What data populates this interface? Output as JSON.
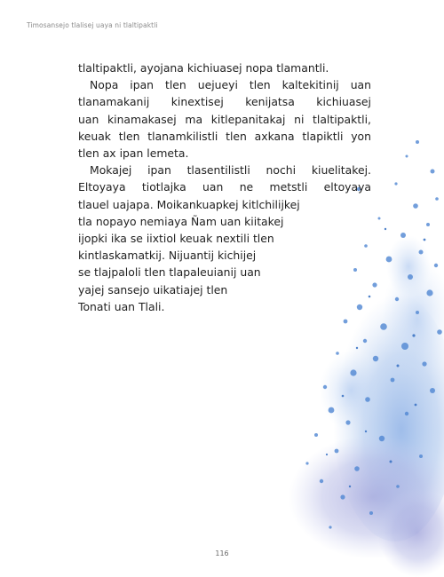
{
  "header": {
    "running_title": "Timosansejo tlalisej uaya ni tlaltipaktli"
  },
  "body": {
    "lines": [
      "tlaltipaktli, ayojana kichiuasej nopa tlamantli.",
      "Nopa ipan tlen uejueyi tlen kaltekitinij uan",
      "tlanamakanij kinextisej kenijatsa kichiuasej",
      "uan kinamakasej ma kitlepanitakaj ni tlaltipaktli,",
      "keuak tlen tlanamkilistli tlen axkana tlapiktli yon",
      "tlen ax ipan lemeta.",
      "Mokajej ipan tlasentilistli nochi kiuelitakej.",
      "Eltoyaya tiotlajka uan ne metstli eltoyaya",
      "tlauel uajapa. Moikankuapkej kitlchilijkej",
      "tla nopayo nemiaya Ñam uan kiitakej",
      "ijopki ika se iixtiol keuak nextili tlen",
      "kintlaskamatkij. Nijuantij kichijej",
      "se tlajpaloli tlen tlapaleuianij uan",
      "yajej sansejo uikatiajej tlen",
      "Tonati uan Tlali."
    ]
  },
  "footer": {
    "page_number": "116"
  },
  "colors": {
    "text": "#1f1f1f",
    "header": "#8a8a8a",
    "watercolor_blue": "#5b8fd6",
    "watercolor_violet": "#9aa0d8"
  }
}
